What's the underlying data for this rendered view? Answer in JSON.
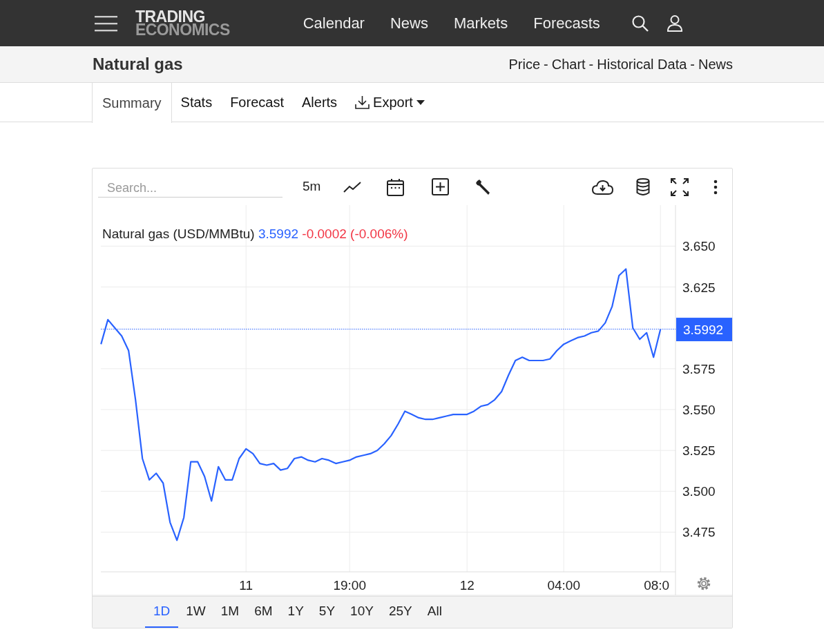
{
  "header": {
    "logo_top": "TRADING",
    "logo_bottom": "ECONOMICS",
    "nav": [
      "Calendar",
      "News",
      "Markets",
      "Forecasts"
    ]
  },
  "title_bar": {
    "title": "Natural gas",
    "links": [
      "Price",
      "Chart",
      "Historical Data",
      "News"
    ],
    "separator": "-"
  },
  "tabs": [
    {
      "label": "Summary",
      "selected": true,
      "kind": "tab"
    },
    {
      "label": "Stats",
      "selected": false,
      "kind": "tab"
    },
    {
      "label": "Forecast",
      "selected": false,
      "kind": "tab"
    },
    {
      "label": "Alerts",
      "selected": false,
      "kind": "tab"
    },
    {
      "label": "Export",
      "selected": false,
      "kind": "dropdown"
    }
  ],
  "chart": {
    "search": {
      "placeholder": "Search..."
    },
    "interval": "5m",
    "legend": {
      "value": "3.5992",
      "change": "-0.0002 (-0.006%)"
    },
    "price_tag": "3.5992",
    "chart_data": {
      "type": "line",
      "categories": [
        null,
        null,
        null,
        null,
        null,
        null,
        null,
        null,
        null,
        null,
        null,
        null,
        null,
        null,
        null,
        null,
        null,
        null,
        null,
        null,
        null,
        "11",
        null,
        null,
        null,
        null,
        null,
        null,
        null,
        null,
        null,
        null,
        null,
        null,
        null,
        null,
        "19:00",
        null,
        null,
        null,
        null,
        null,
        null,
        null,
        null,
        null,
        null,
        null,
        null,
        null,
        null,
        null,
        null,
        "12",
        null,
        null,
        null,
        null,
        null,
        null,
        null,
        null,
        null,
        null,
        null,
        null,
        null,
        "04:00",
        null,
        null,
        null,
        null,
        null,
        null,
        null,
        null,
        null,
        null,
        null,
        null,
        null,
        "08:0"
      ],
      "series": [
        {
          "name": "Natural gas (USD/MMBtu)",
          "color": "#2962ff",
          "values": [
            3.59,
            3.605,
            3.6,
            3.595,
            3.586,
            3.556,
            3.52,
            3.507,
            3.511,
            3.505,
            3.481,
            3.47,
            3.484,
            3.518,
            3.518,
            3.509,
            3.494,
            3.515,
            3.507,
            3.507,
            3.52,
            3.526,
            3.523,
            3.517,
            3.516,
            3.517,
            3.513,
            3.514,
            3.52,
            3.521,
            3.519,
            3.518,
            3.52,
            3.519,
            3.517,
            3.518,
            3.519,
            3.521,
            3.522,
            3.523,
            3.525,
            3.529,
            3.534,
            3.541,
            3.549,
            3.547,
            3.545,
            3.544,
            3.544,
            3.545,
            3.546,
            3.547,
            3.547,
            3.547,
            3.549,
            3.552,
            3.553,
            3.556,
            3.561,
            3.571,
            3.58,
            3.582,
            3.58,
            3.58,
            3.58,
            3.581,
            3.586,
            3.59,
            3.592,
            3.594,
            3.595,
            3.597,
            3.598,
            3.603,
            3.613,
            3.632,
            3.636,
            3.6,
            3.593,
            3.597,
            3.582,
            3.599
          ]
        }
      ],
      "ylim": [
        3.4507,
        3.6751
      ],
      "grid": true,
      "ref_lines": [
        {
          "axis": "y",
          "value": 3.5992,
          "color": "#2962ff"
        }
      ],
      "yticks": [
        {
          "value": 3.65,
          "label": "3.650"
        },
        {
          "value": 3.625,
          "label": "3.625"
        },
        {
          "value": 3.575,
          "label": "3.575"
        },
        {
          "value": 3.55,
          "label": "3.550"
        },
        {
          "value": 3.525,
          "label": "3.525"
        },
        {
          "value": 3.5,
          "label": "3.500"
        },
        {
          "value": 3.475,
          "label": "3.475"
        }
      ]
    },
    "ranges": [
      {
        "label": "1D",
        "selected": true
      },
      {
        "label": "1W",
        "selected": false
      },
      {
        "label": "1M",
        "selected": false
      },
      {
        "label": "6M",
        "selected": false
      },
      {
        "label": "1Y",
        "selected": false
      },
      {
        "label": "5Y",
        "selected": false
      },
      {
        "label": "10Y",
        "selected": false
      },
      {
        "label": "25Y",
        "selected": false
      },
      {
        "label": "All",
        "selected": false
      }
    ]
  }
}
